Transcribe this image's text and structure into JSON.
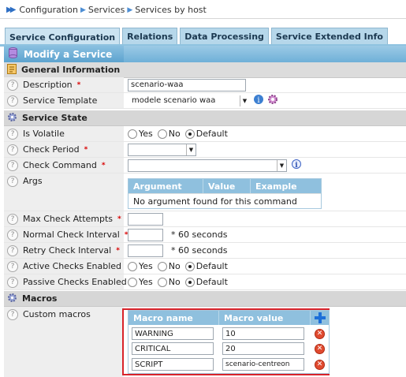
{
  "breadcrumb": {
    "items": [
      "Configuration",
      "Services",
      "Services by host"
    ]
  },
  "tabs": [
    "Service Configuration",
    "Relations",
    "Data Processing",
    "Service Extended Info"
  ],
  "header": {
    "title": "Modify a Service"
  },
  "general": {
    "title": "General Information",
    "description_label": "Description",
    "description_value": "scenario-waa",
    "template_label": "Service Template",
    "template_value": "modele scenario waa"
  },
  "state": {
    "title": "Service State",
    "volatile_label": "Is Volatile",
    "check_period_label": "Check Period",
    "check_command_label": "Check Command",
    "args_label": "Args",
    "args_table": {
      "headers": [
        "Argument",
        "Value",
        "Example"
      ],
      "empty": "No argument found for this command"
    },
    "max_attempts_label": "Max Check Attempts",
    "normal_interval_label": "Normal Check Interval",
    "retry_interval_label": "Retry Check Interval",
    "interval_unit": "* 60 seconds",
    "active_label": "Active Checks Enabled",
    "passive_label": "Passive Checks Enabled"
  },
  "options": {
    "yes": "Yes",
    "no": "No",
    "default": "Default"
  },
  "macros": {
    "title": "Macros",
    "custom_label": "Custom macros",
    "headers": [
      "Macro name",
      "Macro value"
    ],
    "rows": [
      {
        "name": "WARNING",
        "value": "10"
      },
      {
        "name": "CRITICAL",
        "value": "20"
      },
      {
        "name": "SCRIPT",
        "value": "scenario-centreon"
      }
    ]
  },
  "colors": {
    "accent": "#6fb0d8",
    "tab": "#b6d7ea",
    "highlight": "#d8232a"
  }
}
